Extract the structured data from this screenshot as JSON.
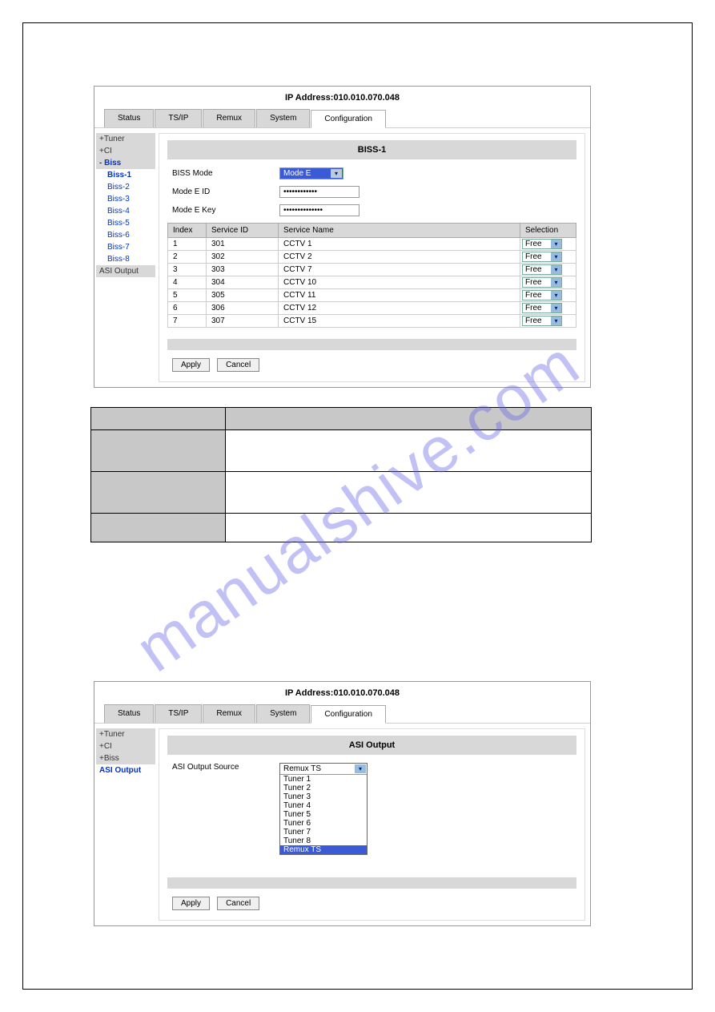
{
  "ip_label": "IP Address:010.010.070.048",
  "tabs": [
    "Status",
    "TS/IP",
    "Remux",
    "System",
    "Configuration"
  ],
  "biss_panel": {
    "sidebar": {
      "tuner": "+Tuner",
      "ci": "+CI",
      "biss_open": "- Biss",
      "biss_items": [
        "Biss-1",
        "Biss-2",
        "Biss-3",
        "Biss-4",
        "Biss-5",
        "Biss-6",
        "Biss-7",
        "Biss-8"
      ],
      "asi": "ASI Output"
    },
    "title": "BISS-1",
    "form": {
      "mode_label": "BISS Mode",
      "mode_value": "Mode E",
      "id_label": "Mode E ID",
      "id_value": "••••••••••••",
      "key_label": "Mode E Key",
      "key_value": "••••••••••••••"
    },
    "table_headers": [
      "Index",
      "Service ID",
      "Service Name",
      "Selection"
    ],
    "rows": [
      {
        "idx": "1",
        "sid": "301",
        "name": "CCTV 1",
        "sel": "Free"
      },
      {
        "idx": "2",
        "sid": "302",
        "name": "CCTV 2",
        "sel": "Free"
      },
      {
        "idx": "3",
        "sid": "303",
        "name": "CCTV 7",
        "sel": "Free"
      },
      {
        "idx": "4",
        "sid": "304",
        "name": "CCTV 10",
        "sel": "Free"
      },
      {
        "idx": "5",
        "sid": "305",
        "name": "CCTV 11",
        "sel": "Free"
      },
      {
        "idx": "6",
        "sid": "306",
        "name": "CCTV 12",
        "sel": "Free"
      },
      {
        "idx": "7",
        "sid": "307",
        "name": "CCTV 15",
        "sel": "Free"
      }
    ]
  },
  "asi_panel": {
    "sidebar": {
      "tuner": "+Tuner",
      "ci": "+CI",
      "biss": "+Biss",
      "asi": "ASI Output"
    },
    "title": "ASI Output",
    "source_label": "ASI Output Source",
    "selected": "Remux TS",
    "options": [
      "Tuner 1",
      "Tuner 2",
      "Tuner 3",
      "Tuner 4",
      "Tuner 5",
      "Tuner 6",
      "Tuner 7",
      "Tuner 8",
      "Remux TS"
    ]
  },
  "buttons": {
    "apply": "Apply",
    "cancel": "Cancel"
  },
  "watermark": "manualshive.com"
}
